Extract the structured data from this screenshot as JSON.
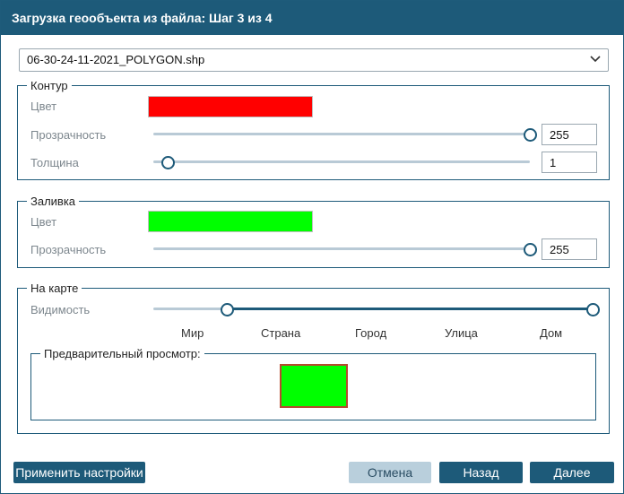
{
  "dialog": {
    "title": "Загрузка геообъекта из файла: Шаг 3 из 4"
  },
  "file_select": {
    "value": "06-30-24-11-2021_POLYGON.shp",
    "icon": "chevron-down-icon"
  },
  "outline": {
    "legend": "Контур",
    "color_label": "Цвет",
    "color": "#ff0000",
    "opacity_label": "Прозрачность",
    "opacity_value": "255",
    "opacity_fraction": 1.0,
    "thickness_label": "Толщина",
    "thickness_value": "1",
    "thickness_fraction": 0.0
  },
  "fill": {
    "legend": "Заливка",
    "color_label": "Цвет",
    "color": "#00ff00",
    "opacity_label": "Прозрачность",
    "opacity_value": "255",
    "opacity_fraction": 1.0
  },
  "map": {
    "legend": "На карте",
    "visibility_label": "Видимость",
    "visibility_range": [
      "Страна",
      "Дом"
    ],
    "scale_labels": [
      "Мир",
      "Страна",
      "Город",
      "Улица",
      "Дом"
    ],
    "preview_legend": "Предварительный просмотр:",
    "preview_fill": "#00ff00",
    "preview_stroke": "#b54a2e"
  },
  "buttons": {
    "apply": "Применить настройки",
    "cancel": "Отмена",
    "back": "Назад",
    "next": "Далее"
  },
  "colors": {
    "accent": "#1d5a79",
    "cancel_bg": "#b9cfdc",
    "track": "#b9cad6"
  }
}
